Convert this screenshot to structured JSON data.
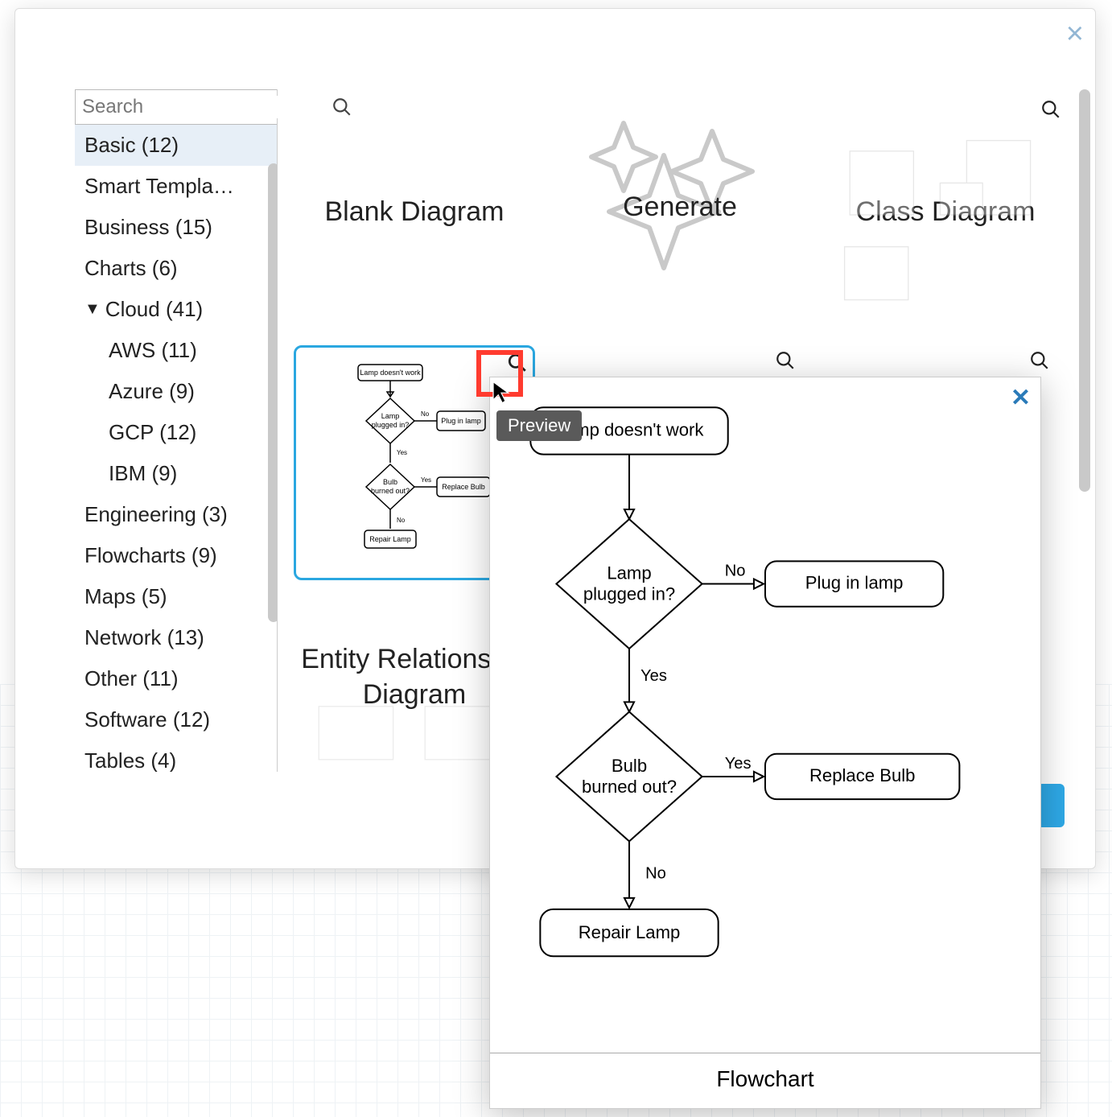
{
  "dialog": {
    "search_placeholder": "Search",
    "categories": [
      {
        "label": "Basic (12)",
        "selected": true
      },
      {
        "label": "Smart Templa…"
      },
      {
        "label": "Business (15)"
      },
      {
        "label": "Charts (6)"
      },
      {
        "label": "Cloud (41)",
        "expandable": true,
        "expanded": true
      },
      {
        "label": "AWS (11)",
        "sub": true
      },
      {
        "label": "Azure (9)",
        "sub": true
      },
      {
        "label": "GCP (12)",
        "sub": true
      },
      {
        "label": "IBM (9)",
        "sub": true
      },
      {
        "label": "Engineering (3)"
      },
      {
        "label": "Flowcharts (9)"
      },
      {
        "label": "Maps (5)"
      },
      {
        "label": "Network (13)"
      },
      {
        "label": "Other (11)"
      },
      {
        "label": "Software (12)"
      },
      {
        "label": "Tables (4)"
      }
    ],
    "templates": {
      "row1": [
        {
          "name": "blank",
          "label": "Blank Diagram"
        },
        {
          "name": "generate",
          "label": "Generate"
        },
        {
          "name": "class",
          "label": "Class Diagram"
        }
      ],
      "row2": [
        {
          "name": "flowchart",
          "label": "Flowchart",
          "selected": true
        }
      ],
      "row3": [
        {
          "name": "erd",
          "label": "Entity Relationship Diagram"
        }
      ]
    },
    "tooltip_label": "Preview"
  },
  "preview": {
    "title": "Flowchart",
    "nodes": {
      "start": "Lamp doesn't work",
      "d1": "Lamp plugged in?",
      "a1": "Plug in lamp",
      "d2": "Bulb burned out?",
      "a2": "Replace Bulb",
      "end": "Repair Lamp"
    },
    "edges": {
      "no": "No",
      "yes": "Yes"
    }
  }
}
